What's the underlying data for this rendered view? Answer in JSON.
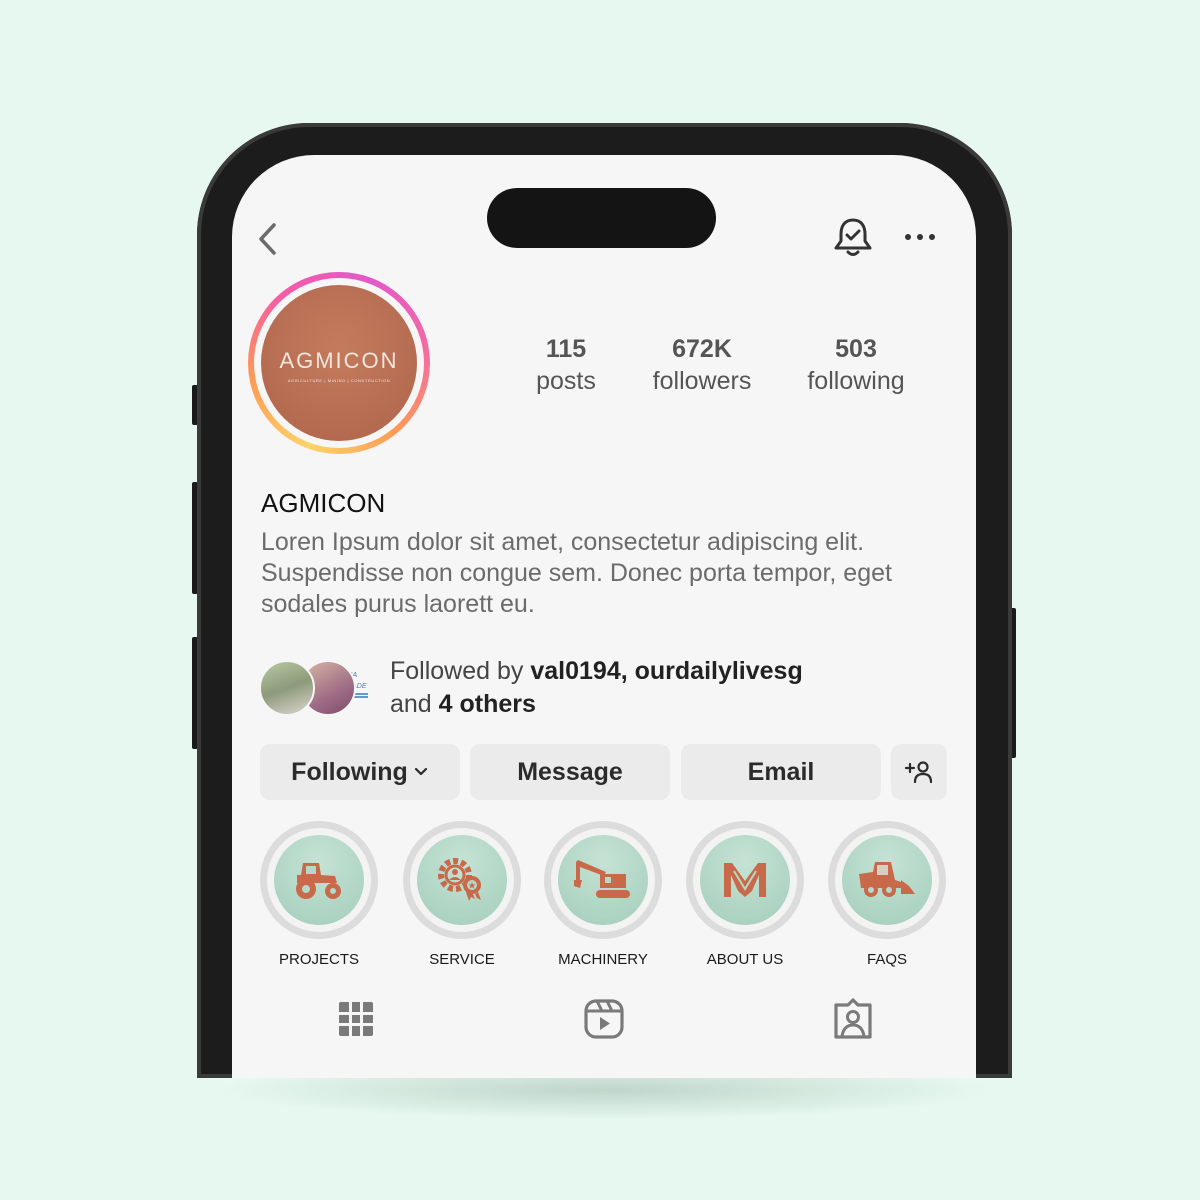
{
  "colors": {
    "background": "#e6f8ef",
    "brand": "#b86e52",
    "highlight_disc": "#b5d9c8",
    "icon_orange": "#c8694a"
  },
  "header": {
    "back_icon": "chevron-left-icon",
    "notification_icon": "bell-check-icon",
    "more_icon": "more-horizontal-icon"
  },
  "profile": {
    "avatar_logo": "AGMICON",
    "avatar_tagline": "AGRICULTURE | MINING | CONSTRUCTION",
    "name": "AGMICON",
    "bio": "Loren Ipsum dolor sit amet, consectetur adipiscing elit. Suspendisse non congue sem. Donec porta tempor, eget sodales purus laorett eu."
  },
  "stats": [
    {
      "value": "115",
      "label": "posts"
    },
    {
      "value": "672K",
      "label": "followers"
    },
    {
      "value": "503",
      "label": "following"
    }
  ],
  "followed_by": {
    "prefix": "Followed by",
    "users": "val0194, ourdailylivesg",
    "and": "and",
    "others": "4 others",
    "avatar_tag": "ALIA DRADE"
  },
  "actions": {
    "following": "Following",
    "message": "Message",
    "email": "Email",
    "add_user_icon": "add-person-icon"
  },
  "highlights": [
    {
      "label": "PROJECTS",
      "icon": "tractor-icon"
    },
    {
      "label": "SERVICE",
      "icon": "gear-badge-icon"
    },
    {
      "label": "MACHINERY",
      "icon": "excavator-icon"
    },
    {
      "label": "ABOUT US",
      "icon": "m-logo-icon"
    },
    {
      "label": "FAQS",
      "icon": "skid-loader-icon"
    }
  ],
  "tabs": [
    {
      "name": "posts-grid",
      "icon": "grid-icon"
    },
    {
      "name": "reels",
      "icon": "reels-icon"
    },
    {
      "name": "tagged",
      "icon": "tagged-person-icon"
    }
  ]
}
